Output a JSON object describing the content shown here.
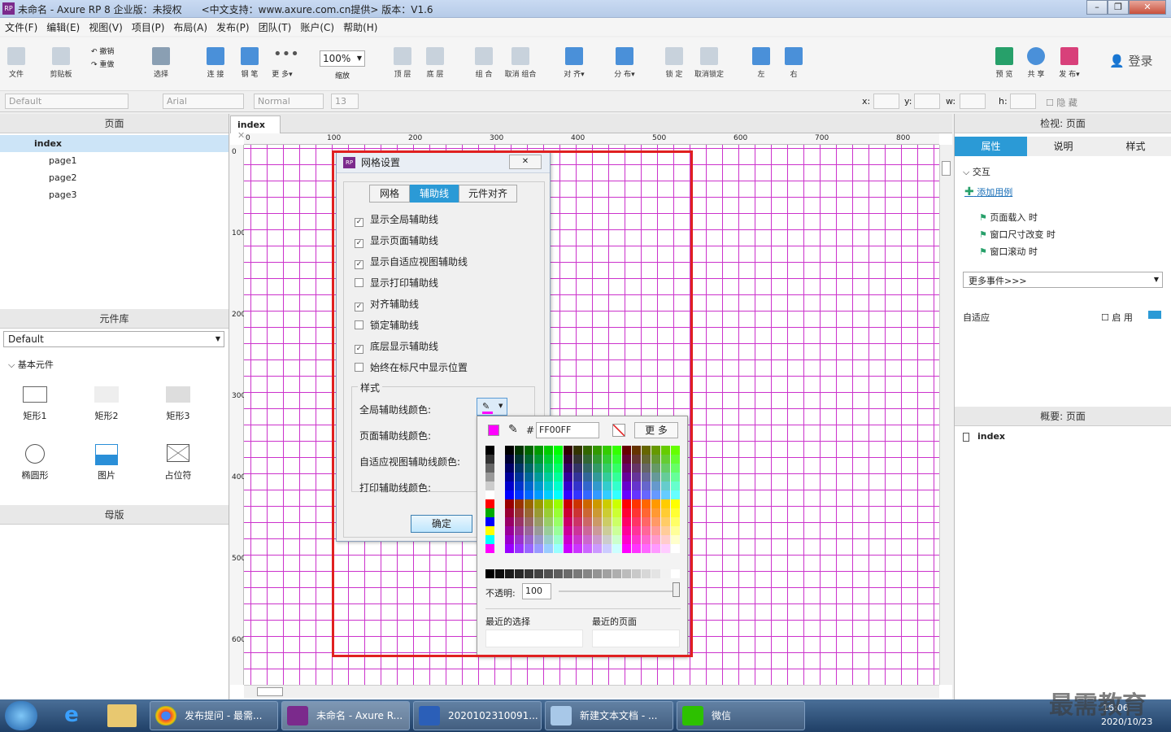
{
  "window": {
    "title": "未命名 - Axure RP 8 企业版：未授权　　<中文支持：www.axure.com.cn提供> 版本：V1.6",
    "logo": "RP"
  },
  "menu": [
    "文件(F)",
    "编辑(E)",
    "视图(V)",
    "项目(P)",
    "布局(A)",
    "发布(P)",
    "团队(T)",
    "账户(C)",
    "帮助(H)"
  ],
  "toolbar": {
    "file": "文件",
    "clipboard": "剪贴板",
    "undo": "撤销",
    "redo": "重做",
    "select": "选择",
    "connect": "连 接",
    "pen": "钢 笔",
    "more": "更 多▾",
    "zoom": "100%",
    "zoom_label": "缩放",
    "top": "顶 层",
    "bottom": "底 层",
    "group": "组 合",
    "ungroup": "取消 组合",
    "align": "对 齐▾",
    "distribute": "分 布▾",
    "lock": "锁 定",
    "unlock": "取消锁定",
    "left": "左",
    "right": "右",
    "preview": "预 览",
    "share": "共 享",
    "publish": "发 布▾",
    "login": "登录"
  },
  "format": {
    "style": "Default",
    "font": "Arial",
    "weight": "Normal",
    "size": "13",
    "x": "x:",
    "y": "y:",
    "w": "w:",
    "h": "h:",
    "hidden": "隐 藏"
  },
  "pages": {
    "header": "页面",
    "items": [
      "index",
      "page1",
      "page2",
      "page3"
    ]
  },
  "library": {
    "header": "元件库",
    "select": "Default",
    "group": "基本元件",
    "items": [
      "矩形1",
      "矩形2",
      "矩形3",
      "椭圆形",
      "图片",
      "占位符"
    ]
  },
  "masters": {
    "header": "母版"
  },
  "canvas": {
    "tab": "index",
    "ruler_h": [
      "0",
      "100",
      "200",
      "300",
      "400",
      "500",
      "600",
      "700",
      "800"
    ],
    "ruler_v": [
      "0",
      "100",
      "200",
      "300",
      "400",
      "500",
      "600"
    ]
  },
  "dialog": {
    "title": "网格设置",
    "tabs": [
      "网格",
      "辅助线",
      "元件对齐"
    ],
    "options": [
      {
        "label": "显示全局辅助线",
        "checked": true
      },
      {
        "label": "显示页面辅助线",
        "checked": true
      },
      {
        "label": "显示自适应视图辅助线",
        "checked": true
      },
      {
        "label": "显示打印辅助线",
        "checked": false
      },
      {
        "label": "对齐辅助线",
        "checked": true
      },
      {
        "label": "锁定辅助线",
        "checked": false
      },
      {
        "label": "底层显示辅助线",
        "checked": true
      },
      {
        "label": "始终在标尺中显示位置",
        "checked": false
      }
    ],
    "style_group": "样式",
    "colors": [
      "全局辅助线颜色:",
      "页面辅助线颜色:",
      "自适应视图辅助线颜色:",
      "打印辅助线颜色:"
    ],
    "ok": "确定",
    "check_mark": "✓"
  },
  "picker": {
    "hash": "#",
    "hex": "FF00FF",
    "more": "更 多",
    "opacity_label": "不透明:",
    "opacity": "100",
    "recent_sel": "最近的选择",
    "recent_page": "最近的页面",
    "current_color": "#FF00FF"
  },
  "inspector": {
    "header": "检视: 页面",
    "tabs": [
      "属性",
      "说明",
      "样式"
    ],
    "interaction": "交互",
    "add_case": "添加用例",
    "events": [
      "页面载入 时",
      "窗口尺寸改变 时",
      "窗口滚动 时"
    ],
    "more_events": "更多事件>>>",
    "adaptive": "自适应",
    "enable": "启 用"
  },
  "outline": {
    "header": "概要: 页面",
    "item": "index"
  },
  "taskbar": {
    "items": [
      "发布提问 - 最需...",
      "未命名 - Axure R...",
      "2020102310091...",
      "新建文本文档 - ...",
      "微信"
    ],
    "time": "16:06",
    "date": "2020/10/23",
    "watermark": "最需教育"
  }
}
